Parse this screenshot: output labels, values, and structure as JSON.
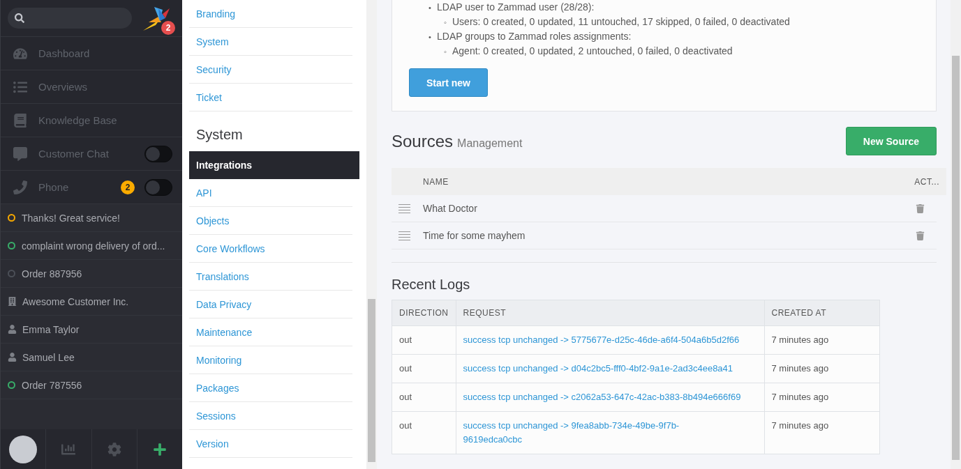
{
  "sidebar": {
    "logo_badge": "2",
    "nav": [
      {
        "label": "Dashboard"
      },
      {
        "label": "Overviews"
      },
      {
        "label": "Knowledge Base"
      },
      {
        "label": "Customer Chat",
        "switch_on": false
      },
      {
        "label": "Phone",
        "badge": "2",
        "switch_on": false
      }
    ],
    "tasks": [
      {
        "kind": "ticket",
        "label": "Thanks! Great service!",
        "color": "#f6a800"
      },
      {
        "kind": "ticket",
        "label": "complaint wrong delivery of ord...",
        "color": "#38ad69"
      },
      {
        "kind": "ticket",
        "label": "Order 887956",
        "color": "#4b4f57"
      },
      {
        "kind": "organization",
        "label": "Awesome Customer Inc."
      },
      {
        "kind": "user",
        "label": "Emma Taylor"
      },
      {
        "kind": "user",
        "label": "Samuel Lee"
      },
      {
        "kind": "ticket",
        "label": "Order 787556",
        "color": "#38ad69"
      }
    ]
  },
  "settings_nav": {
    "top_items": [
      {
        "label": "Branding",
        "selected": false
      },
      {
        "label": "System",
        "selected": false
      },
      {
        "label": "Security",
        "selected": false
      },
      {
        "label": "Ticket",
        "selected": false
      }
    ],
    "sections": [
      {
        "title": "System",
        "items": [
          {
            "label": "Integrations",
            "selected": true
          },
          {
            "label": "API",
            "selected": false
          },
          {
            "label": "Objects",
            "selected": false
          },
          {
            "label": "Core Workflows",
            "selected": false
          },
          {
            "label": "Translations",
            "selected": false
          },
          {
            "label": "Data Privacy",
            "selected": false
          },
          {
            "label": "Maintenance",
            "selected": false
          },
          {
            "label": "Monitoring",
            "selected": false
          },
          {
            "label": "Packages",
            "selected": false
          },
          {
            "label": "Sessions",
            "selected": false
          },
          {
            "label": "Version",
            "selected": false
          }
        ]
      }
    ]
  },
  "sync_summary": {
    "items": [
      {
        "marker": "•",
        "text": "LDAP user to Zammad user (28/28):",
        "children": [
          {
            "marker": "◦",
            "text": "Users: 0 created, 0 updated, 11 untouched, 17 skipped, 0 failed, 0 deactivated"
          }
        ]
      },
      {
        "marker": "•",
        "text": "LDAP groups to Zammad roles assignments:",
        "children": [
          {
            "marker": "◦",
            "text": "Agent: 0 created, 0 updated, 2 untouched, 0 failed, 0 deactivated"
          }
        ]
      }
    ],
    "button": "Start new"
  },
  "sources": {
    "title": "Sources",
    "subtitle": "Management",
    "button": "New Source",
    "columns": [
      "NAME",
      "ACT..."
    ],
    "rows": [
      {
        "name": "What Doctor"
      },
      {
        "name": "Time for some mayhem"
      }
    ]
  },
  "recent_logs": {
    "title": "Recent Logs",
    "columns": [
      "DIRECTION",
      "REQUEST",
      "CREATED AT"
    ],
    "rows": [
      {
        "direction": "out",
        "request": "success tcp unchanged -> 5775677e-d25c-46de-a6f4-504a6b5d2f66",
        "created_at": "7 minutes ago"
      },
      {
        "direction": "out",
        "request": "success tcp unchanged -> d04c2bc5-fff0-4bf2-9a1e-2ad3c4ee8a41",
        "created_at": "7 minutes ago"
      },
      {
        "direction": "out",
        "request": "success tcp unchanged -> c2062a53-647c-42ac-b383-8b494e666f69",
        "created_at": "7 minutes ago"
      },
      {
        "direction": "out",
        "request": "success tcp unchanged -> 9fea8abb-734e-49be-9f7b-9619edca0cbc",
        "created_at": "7 minutes ago"
      }
    ]
  }
}
